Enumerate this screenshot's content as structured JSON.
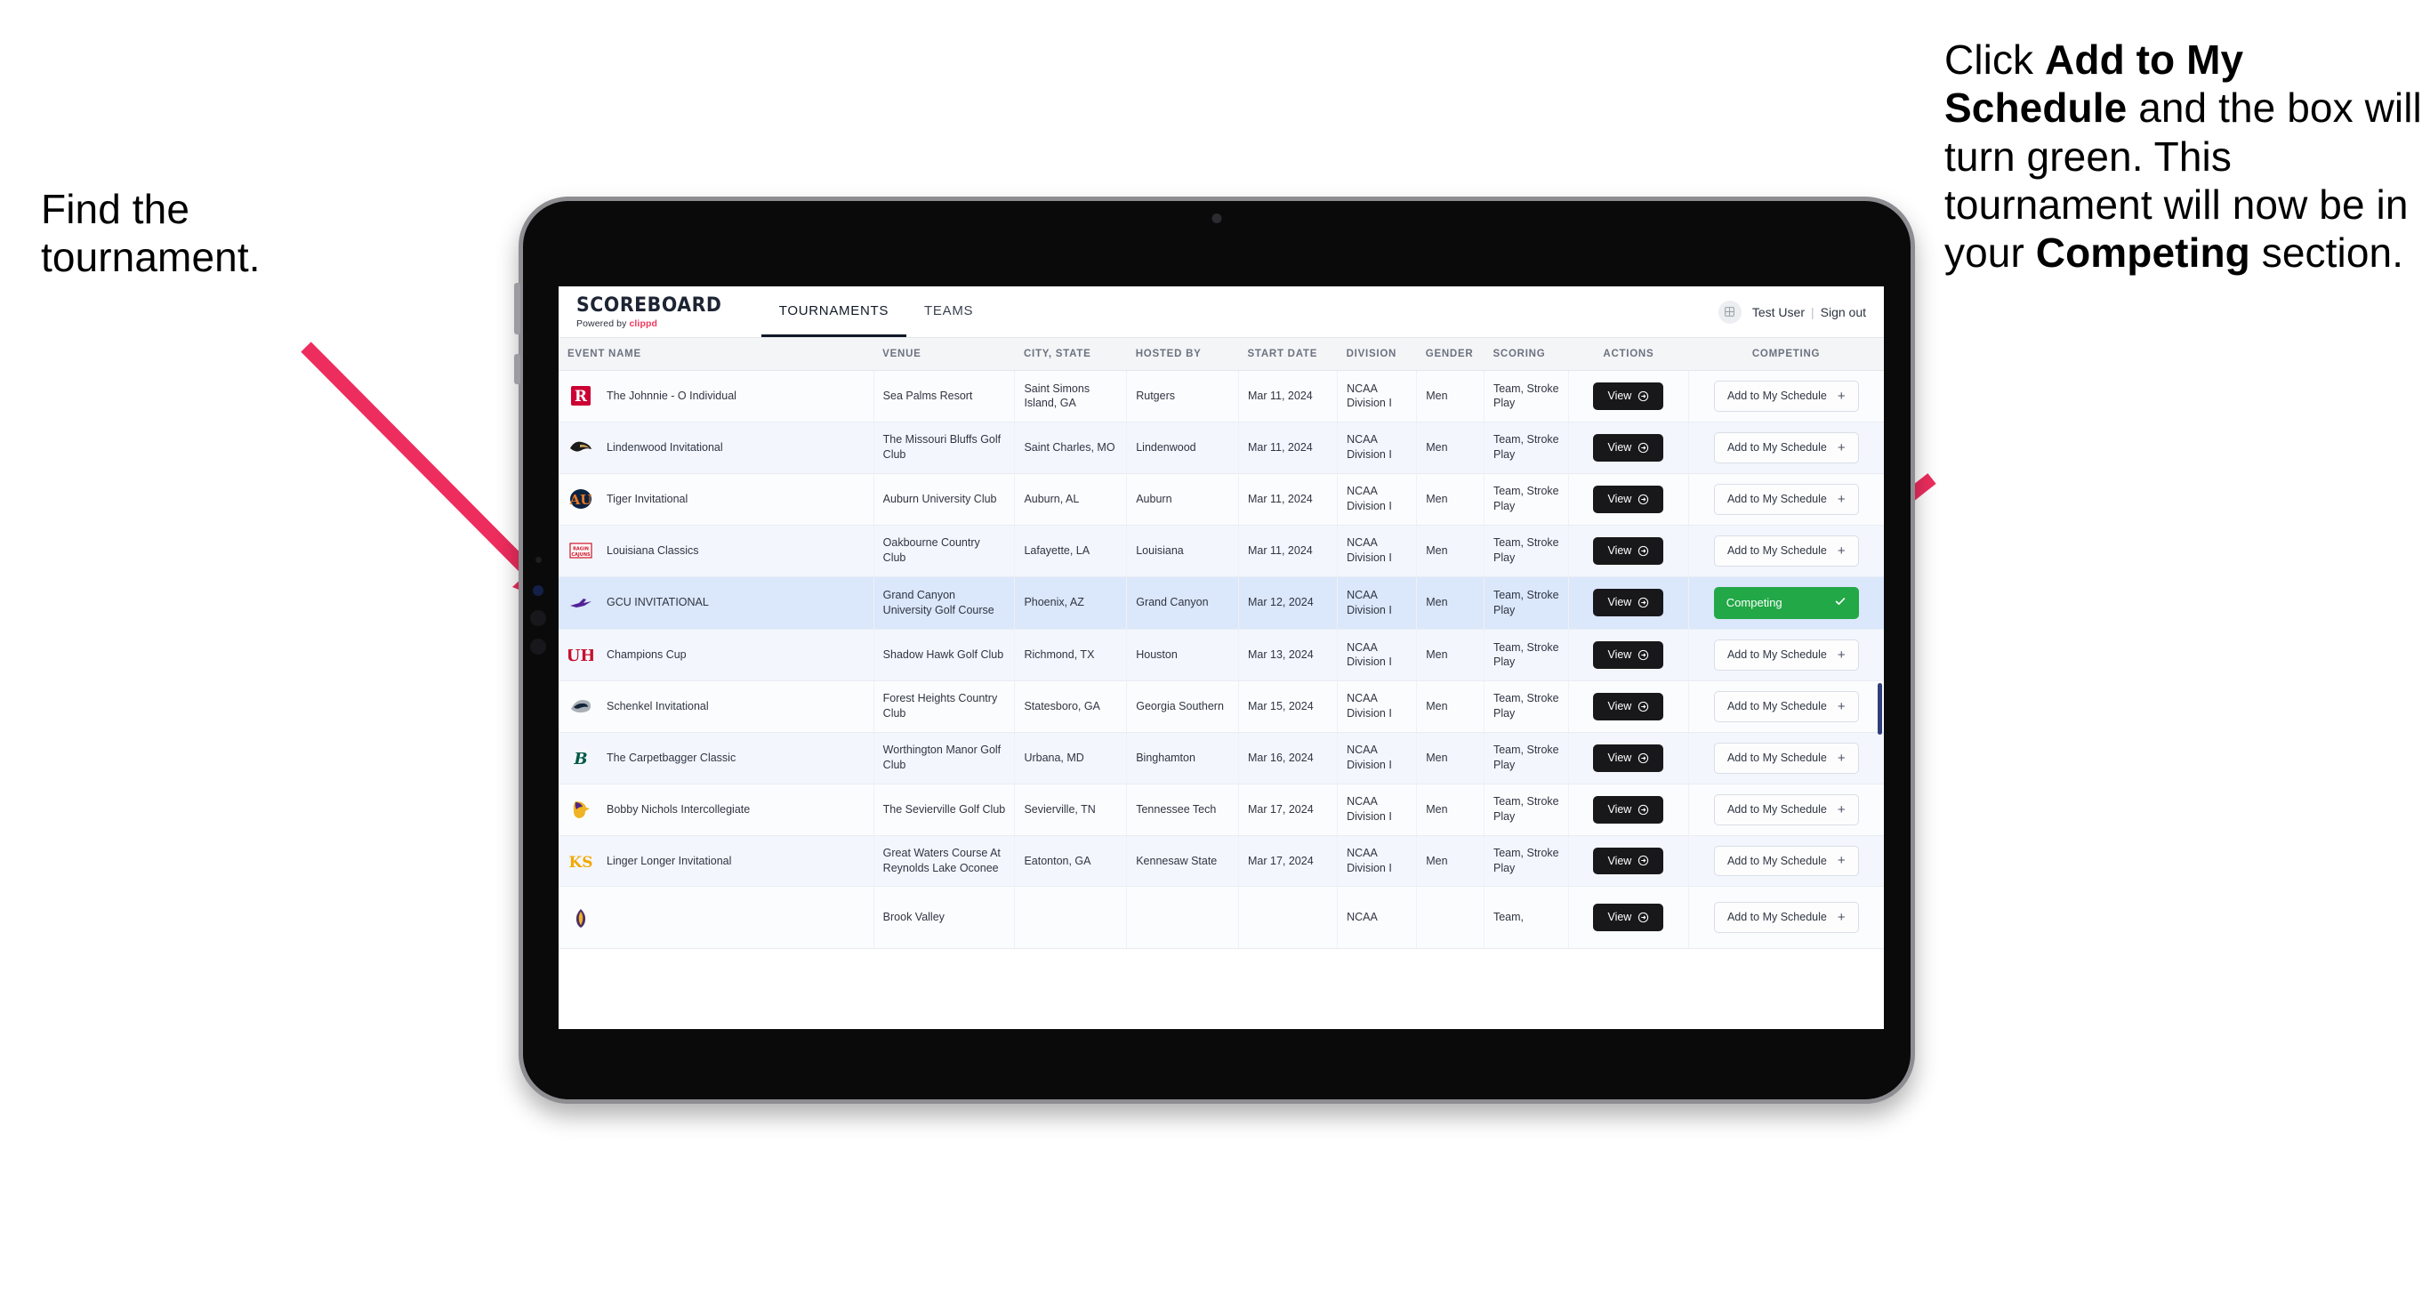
{
  "annotations": {
    "left": {
      "lines": [
        "Find the",
        "tournament."
      ]
    },
    "right": {
      "segments": [
        {
          "t": "Click ",
          "bold": false
        },
        {
          "t": "Add to My Schedule",
          "bold": true
        },
        {
          "t": " and the box will turn green. This tournament will now be in your ",
          "bold": false
        },
        {
          "t": "Competing",
          "bold": true
        },
        {
          "t": " section.",
          "bold": false
        }
      ]
    }
  },
  "colors": {
    "arrow": "#ED2D5E",
    "competing_green": "#22a846",
    "view_black": "#18181b",
    "selected_row": "#dbe7fb",
    "brand_accent": "#f0365e"
  },
  "app": {
    "brand": {
      "title": "SCOREBOARD",
      "powered_prefix": "Powered by ",
      "powered_name": "clippd"
    },
    "nav": {
      "tabs": [
        {
          "label": "TOURNAMENTS",
          "active": true
        },
        {
          "label": "TEAMS",
          "active": false
        }
      ]
    },
    "user": {
      "name": "Test User",
      "separator": "|",
      "signout": "Sign out",
      "avatar_icon": "user-avatar-icon"
    },
    "table": {
      "columns": [
        "EVENT NAME",
        "VENUE",
        "CITY, STATE",
        "HOSTED BY",
        "START DATE",
        "DIVISION",
        "GENDER",
        "SCORING",
        "ACTIONS",
        "COMPETING"
      ],
      "add_label": "Add to My Schedule",
      "add_plus": "+",
      "view_label": "View",
      "competing_label": "Competing",
      "rows": [
        {
          "logo": "rutgers-logo",
          "event": "The Johnnie - O Individual",
          "venue": "Sea Palms Resort",
          "city": "Saint Simons Island, GA",
          "host": "Rutgers",
          "date": "Mar 11, 2024",
          "division": "NCAA Division I",
          "gender": "Men",
          "scoring": "Team, Stroke Play",
          "competing": false
        },
        {
          "logo": "lindenwood-logo",
          "event": "Lindenwood Invitational",
          "venue": "The Missouri Bluffs Golf Club",
          "city": "Saint Charles, MO",
          "host": "Lindenwood",
          "date": "Mar 11, 2024",
          "division": "NCAA Division I",
          "gender": "Men",
          "scoring": "Team, Stroke Play",
          "competing": false
        },
        {
          "logo": "auburn-logo",
          "event": "Tiger Invitational",
          "venue": "Auburn University Club",
          "city": "Auburn, AL",
          "host": "Auburn",
          "date": "Mar 11, 2024",
          "division": "NCAA Division I",
          "gender": "Men",
          "scoring": "Team, Stroke Play",
          "competing": false
        },
        {
          "logo": "louisiana-logo",
          "event": "Louisiana Classics",
          "venue": "Oakbourne Country Club",
          "city": "Lafayette, LA",
          "host": "Louisiana",
          "date": "Mar 11, 2024",
          "division": "NCAA Division I",
          "gender": "Men",
          "scoring": "Team, Stroke Play",
          "competing": false
        },
        {
          "logo": "gcu-logo",
          "event": "GCU INVITATIONAL",
          "venue": "Grand Canyon University Golf Course",
          "city": "Phoenix, AZ",
          "host": "Grand Canyon",
          "date": "Mar 12, 2024",
          "division": "NCAA Division I",
          "gender": "Men",
          "scoring": "Team, Stroke Play",
          "competing": true
        },
        {
          "logo": "houston-logo",
          "event": "Champions Cup",
          "venue": "Shadow Hawk Golf Club",
          "city": "Richmond, TX",
          "host": "Houston",
          "date": "Mar 13, 2024",
          "division": "NCAA Division I",
          "gender": "Men",
          "scoring": "Team, Stroke Play",
          "competing": false
        },
        {
          "logo": "georgia-southern-logo",
          "event": "Schenkel Invitational",
          "venue": "Forest Heights Country Club",
          "city": "Statesboro, GA",
          "host": "Georgia Southern",
          "date": "Mar 15, 2024",
          "division": "NCAA Division I",
          "gender": "Men",
          "scoring": "Team, Stroke Play",
          "competing": false
        },
        {
          "logo": "binghamton-logo",
          "event": "The Carpetbagger Classic",
          "venue": "Worthington Manor Golf Club",
          "city": "Urbana, MD",
          "host": "Binghamton",
          "date": "Mar 16, 2024",
          "division": "NCAA Division I",
          "gender": "Men",
          "scoring": "Team, Stroke Play",
          "competing": false
        },
        {
          "logo": "tennessee-tech-logo",
          "event": "Bobby Nichols Intercollegiate",
          "venue": "The Sevierville Golf Club",
          "city": "Sevierville, TN",
          "host": "Tennessee Tech",
          "date": "Mar 17, 2024",
          "division": "NCAA Division I",
          "gender": "Men",
          "scoring": "Team, Stroke Play",
          "competing": false
        },
        {
          "logo": "kennesaw-state-logo",
          "event": "Linger Longer Invitational",
          "venue": "Great Waters Course At Reynolds Lake Oconee",
          "city": "Eatonton, GA",
          "host": "Kennesaw State",
          "date": "Mar 17, 2024",
          "division": "NCAA Division I",
          "gender": "Men",
          "scoring": "Team, Stroke Play",
          "competing": false
        },
        {
          "logo": "east-carolina-logo",
          "event": "",
          "venue": "Brook Valley",
          "city": "",
          "host": "",
          "date": "",
          "division": "NCAA",
          "gender": "",
          "scoring": "Team,",
          "competing": false,
          "clipped": true
        }
      ]
    }
  }
}
